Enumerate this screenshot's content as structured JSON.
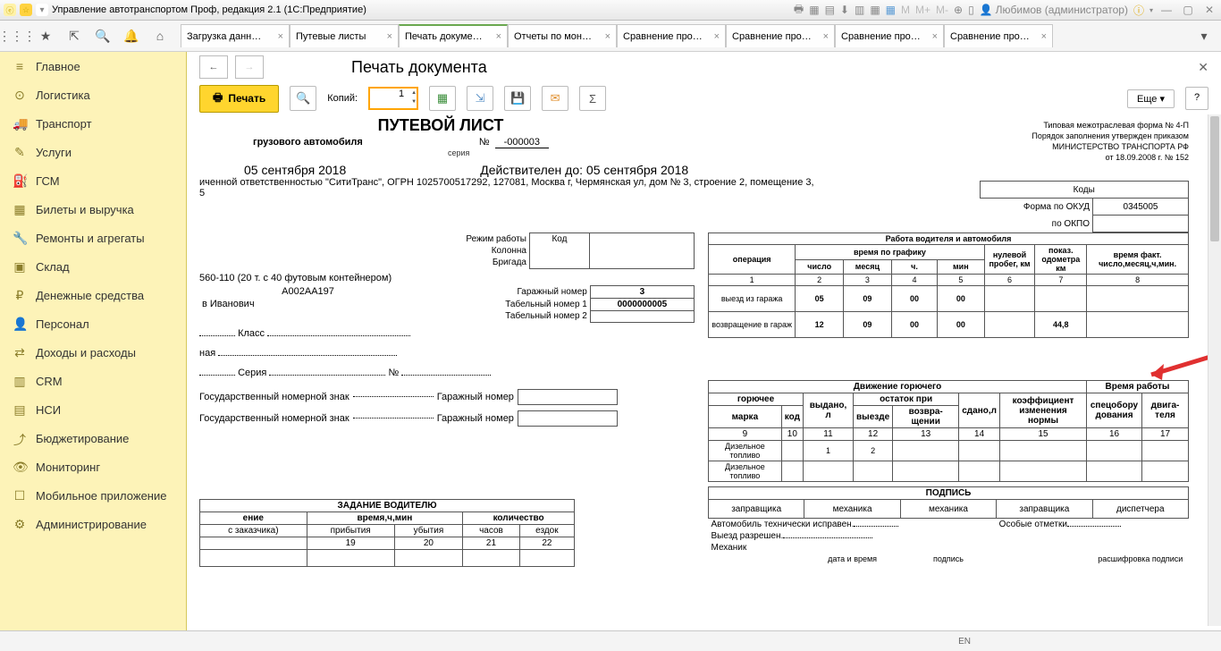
{
  "window": {
    "title": "Управление автотранспортом Проф, редакция 2.1  (1С:Предприятие)",
    "user": "Любимов (администратор)"
  },
  "topTabs": [
    {
      "label": "Загрузка данн…"
    },
    {
      "label": "Путевые листы"
    },
    {
      "label": "Печать докуме…",
      "active": true
    },
    {
      "label": "Отчеты по мон…"
    },
    {
      "label": "Сравнение про…"
    },
    {
      "label": "Сравнение про…"
    },
    {
      "label": "Сравнение про…"
    },
    {
      "label": "Сравнение про…"
    }
  ],
  "sidebar": [
    "Главное",
    "Логистика",
    "Транспорт",
    "Услуги",
    "ГСМ",
    "Билеты и выручка",
    "Ремонты и агрегаты",
    "Склад",
    "Денежные средства",
    "Персонал",
    "Доходы и расходы",
    "CRM",
    "НСИ",
    "Бюджетирование",
    "Мониторинг",
    "Мобильное приложение",
    "Администрирование"
  ],
  "sidebarIcons": [
    "≡",
    "⊙",
    "🚚",
    "✎",
    "⛽",
    "▦",
    "🔧",
    "▣",
    "₽",
    "👤",
    "⇄",
    "▥",
    "▤",
    "⤴",
    "👁",
    "☐",
    "⚙"
  ],
  "page": {
    "title": "Печать документа",
    "print": "Печать",
    "copiesLabel": "Копий:",
    "copies": "1",
    "more": "Еще"
  },
  "meta": {
    "line1": "Типовая межотраслевая форма № 4-П",
    "line2": "Порядок заполнения утвержден приказом",
    "line3": "МИНИСТЕРСТВО ТРАНСПОРТА РФ",
    "line4": "от 18.09.2008 г. № 152"
  },
  "doc": {
    "title": "ПУТЕВОЙ ЛИСТ",
    "subtitle": "грузового автомобиля",
    "seriesLbl": "серия",
    "numLbl": "№",
    "num": "-000003",
    "date": "05 сентября 2018",
    "validLbl": "Действителен до:",
    "validDate": "05 сентября 2018",
    "org": "иченной ответственностью  \"СитиТранс\", ОГРН 1025700517292, 127081, Москва г, Чермянская ул, дом № 3, строение 2, помещение 3,",
    "org2": "5",
    "kody": "Коды",
    "okud": "Форма по ОКУД",
    "okudVal": "0345005",
    "okpo": "по ОКПО",
    "truck": "560-110 (20 т. с 40 футовым контейнером)",
    "plate": "А002АА197",
    "driver": "в Иванович",
    "klass": "Класс",
    "seria": "Серия",
    "rezhim": "Режим работы",
    "kolonna": "Колонна",
    "brigada": "Бригада",
    "kod": "Код",
    "garN": "Гаражный номер",
    "garNVal": "3",
    "tabN1": "Табельный номер 1",
    "tabN1Val": "0000000005",
    "tabN2": "Табельный номер 2",
    "gosN": "Государственный номерной знак",
    "gosGar": "Гаражный номер"
  },
  "work": {
    "caption": "Работа водителя и автомобиля",
    "h": [
      "операция",
      "время по графику",
      "нулевой пробег, км",
      "показ. одометра км",
      "время факт. число,месяц,ч,мин."
    ],
    "sub": [
      "число",
      "месяц",
      "ч.",
      "мин"
    ],
    "idx": [
      "1",
      "2",
      "3",
      "4",
      "5",
      "6",
      "7",
      "8"
    ],
    "rows": [
      {
        "op": "выезд из гаража",
        "d": "05",
        "m": "09",
        "h": "00",
        "mi": "00",
        "p": "",
        "od": "",
        "f": ""
      },
      {
        "op": "возвращение в гараж",
        "d": "12",
        "m": "09",
        "h": "00",
        "mi": "00",
        "p": "",
        "od": "44,8",
        "f": ""
      }
    ]
  },
  "fuel": {
    "caption": "Движение горючего",
    "timeCap": "Время работы",
    "h1": [
      "горючее",
      "выдано, л",
      "остаток при",
      "сдано,л",
      "коэффициент изменения нормы",
      "спецобору дования",
      "двига- теля"
    ],
    "h2": [
      "марка",
      "код",
      "",
      "выезде",
      "возвра- щении",
      "",
      "",
      "",
      ""
    ],
    "idx": [
      "9",
      "10",
      "11",
      "12",
      "13",
      "14",
      "15",
      "16",
      "17"
    ],
    "rows": [
      [
        "Дизельное топливо",
        "",
        "1",
        "2",
        "",
        "",
        "",
        "",
        ""
      ],
      [
        "Дизельное топливо",
        "",
        "",
        "",
        "",
        "",
        "",
        "",
        ""
      ]
    ]
  },
  "sign": {
    "caption": "ПОДПИСЬ",
    "cells": [
      "заправщика",
      "механика",
      "механика",
      "заправщика",
      "диспетчера"
    ],
    "foot1": "Автомобиль технически исправен.",
    "foot2": "Особые отметки",
    "foot3": "Выезд разрешен.",
    "foot4": "Механик",
    "col1": "дата и время",
    "col2": "подпись",
    "col3": "расшифровка подписи"
  },
  "task": {
    "caption": "ЗАДАНИЕ ВОДИТЕЛЮ",
    "h": [
      "ение",
      "время,ч,мин",
      "количество"
    ],
    "sub": [
      "с заказчика)",
      "прибытия",
      "убытия",
      "часов",
      "ездок"
    ],
    "idx": [
      "",
      "19",
      "20",
      "21",
      "22"
    ]
  },
  "left2": {
    "naya": "ная"
  },
  "status": {
    "lang": "EN"
  }
}
